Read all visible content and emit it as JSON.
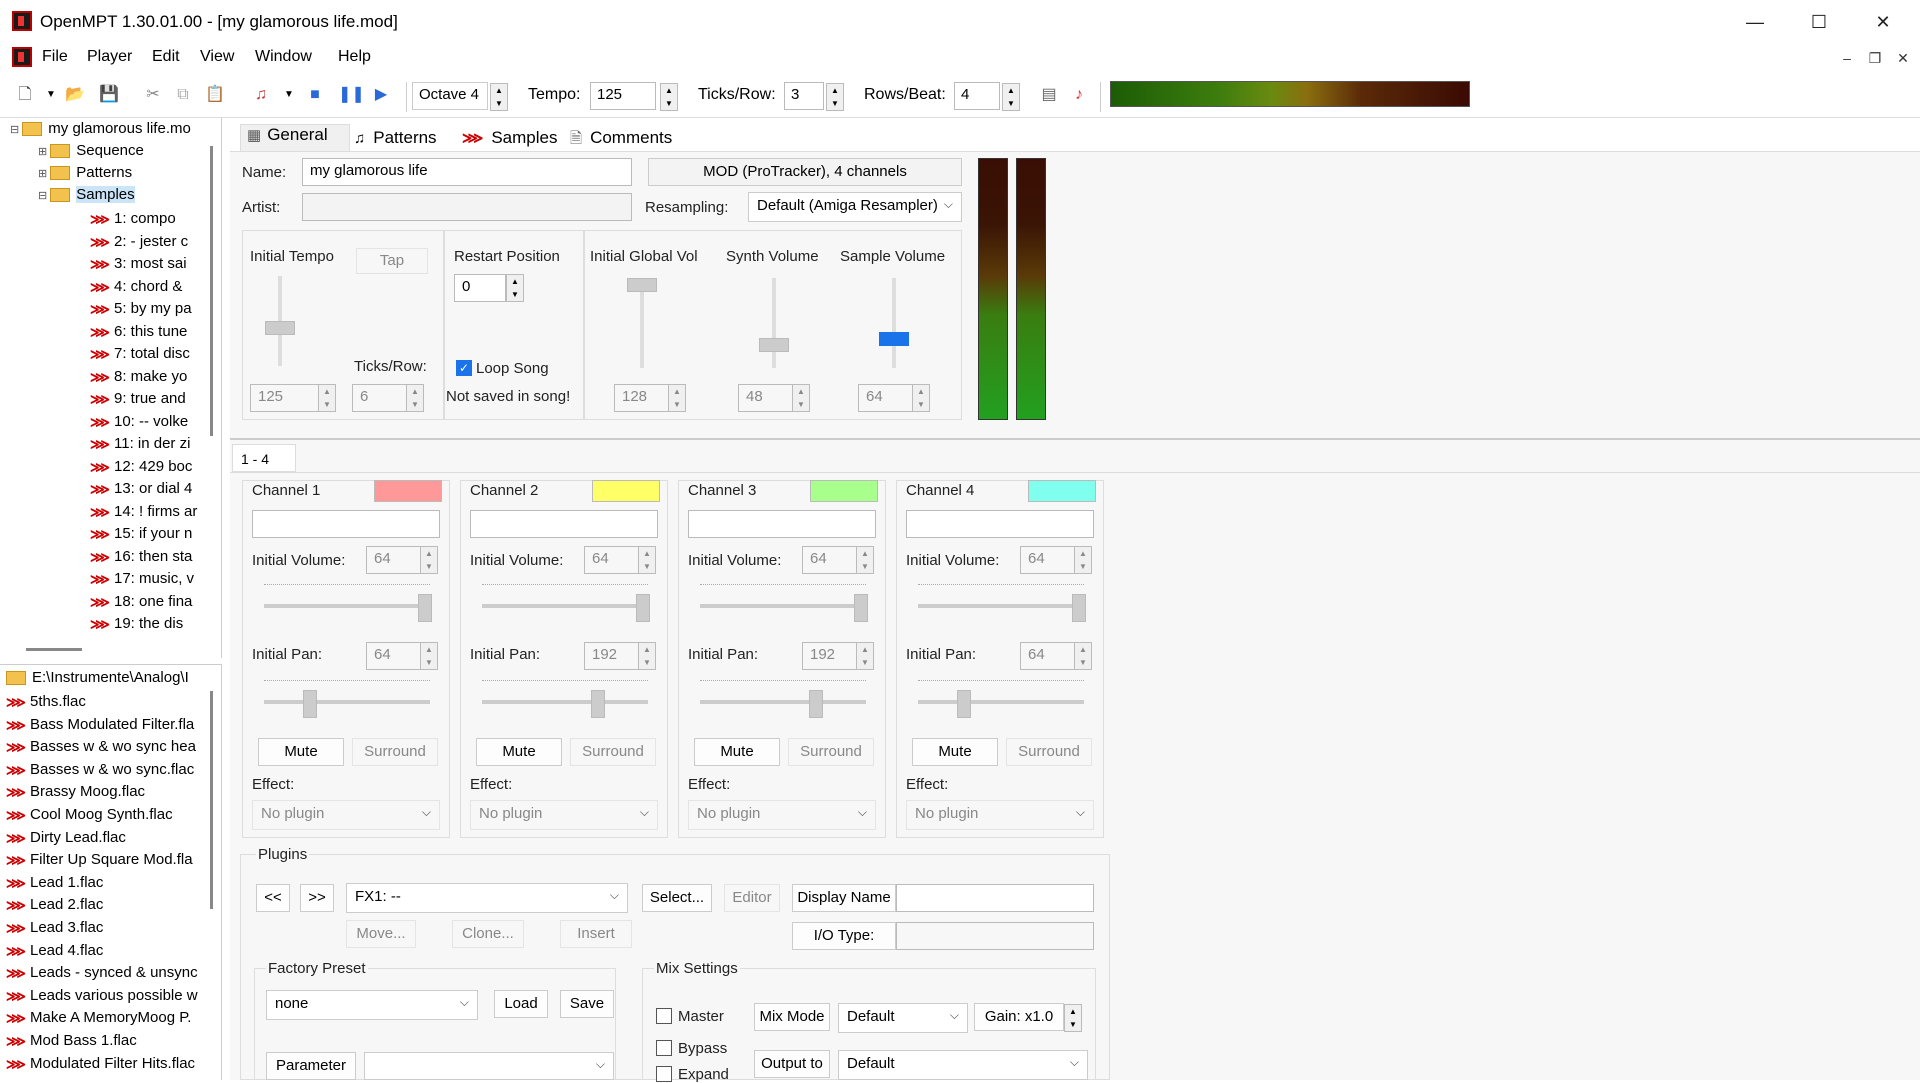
{
  "window": {
    "title": "OpenMPT 1.30.01.00 - [my glamorous life.mod]",
    "minimize": "—",
    "maximize": "☐",
    "close": "✕"
  },
  "menu": {
    "items": [
      "File",
      "Player",
      "Edit",
      "View",
      "Window",
      "Help"
    ]
  },
  "toolbar": {
    "octave": "Octave 4",
    "tempo_label": "Tempo:",
    "tempo": "125",
    "ticks_label": "Ticks/Row:",
    "ticks": "3",
    "rows_label": "Rows/Beat:",
    "rows": "4"
  },
  "tree": {
    "root": "my glamorous life.mo",
    "sequence": "Sequence",
    "patterns": "Patterns",
    "samples": "Samples",
    "items": [
      "1:    compo",
      "2:  - jester c",
      "3:  most sai",
      "4:  chord &",
      "5:  by my pa",
      "6: this tune",
      "7: total disc",
      "8: make yo",
      "9:  true and",
      "10:   -- volke",
      "11: in der zi",
      "12: 429 boc",
      "13: or dial 4",
      "14: ! firms ar",
      "15: if your n",
      "16:  then sta",
      "17:  music, v",
      "18: one fina",
      "19:  the dis"
    ]
  },
  "files": {
    "path": "E:\\Instrumente\\Analog\\I",
    "items": [
      "5ths.flac",
      "Bass Modulated Filter.fla",
      "Basses w & wo sync hea",
      "Basses w & wo sync.flac",
      "Brassy Moog.flac",
      "Cool Moog Synth.flac",
      "Dirty Lead.flac",
      "Filter Up Square Mod.fla",
      "Lead 1.flac",
      "Lead 2.flac",
      "Lead 3.flac",
      "Lead 4.flac",
      "Leads - synced & unsync",
      "Leads various possible w",
      "Make A MemoryMoog P.",
      "Mod Bass 1.flac",
      "Modulated Filter Hits.flac"
    ]
  },
  "tabs": [
    "General",
    "Patterns",
    "Samples",
    "Comments"
  ],
  "general": {
    "name_label": "Name:",
    "name": "my glamorous life",
    "format": "MOD (ProTracker), 4 channels",
    "artist_label": "Artist:",
    "artist": "",
    "resampling_label": "Resampling:",
    "resampling": "Default (Amiga Resampler)",
    "initial_tempo": "Initial Tempo",
    "tap": "Tap",
    "tempo_val": "125",
    "ticks_label": "Ticks/Row:",
    "ticks_val": "6",
    "restart_label": "Restart Position",
    "restart_val": "0",
    "loop_song": "Loop Song",
    "not_saved": "Not saved in song!",
    "global_vol": "Initial Global Vol",
    "global_val": "128",
    "synth_vol": "Synth Volume",
    "synth_val": "48",
    "sample_vol": "Sample Volume",
    "sample_val": "64"
  },
  "channels_tab": "1 - 4",
  "channels": [
    {
      "label": "Channel 1",
      "color": "#ff9999",
      "vol_label": "Initial Volume:",
      "vol": "64",
      "pan_label": "Initial Pan:",
      "pan": "64",
      "pan_level": 0.25,
      "mute": "Mute",
      "surround": "Surround",
      "effect_label": "Effect:",
      "effect": "No plugin"
    },
    {
      "label": "Channel 2",
      "color": "#ffff66",
      "vol_label": "Initial Volume:",
      "vol": "64",
      "pan_label": "Initial Pan:",
      "pan": "192",
      "pan_level": 0.75,
      "mute": "Mute",
      "surround": "Surround",
      "effect_label": "Effect:",
      "effect": "No plugin"
    },
    {
      "label": "Channel 3",
      "color": "#a8ff8c",
      "vol_label": "Initial Volume:",
      "vol": "64",
      "pan_label": "Initial Pan:",
      "pan": "192",
      "pan_level": 0.75,
      "mute": "Mute",
      "surround": "Surround",
      "effect_label": "Effect:",
      "effect": "No plugin"
    },
    {
      "label": "Channel 4",
      "color": "#80ffee",
      "vol_label": "Initial Volume:",
      "vol": "64",
      "pan_label": "Initial Pan:",
      "pan": "64",
      "pan_level": 0.25,
      "mute": "Mute",
      "surround": "Surround",
      "effect_label": "Effect:",
      "effect": "No plugin"
    }
  ],
  "plugins": {
    "title": "Plugins",
    "prev": "<<",
    "next": ">>",
    "fx": "FX1: --",
    "select": "Select...",
    "editor": "Editor",
    "display_name": "Display Name",
    "move": "Move...",
    "clone": "Clone...",
    "insert": "Insert",
    "io_type": "I/O Type:",
    "factory_preset": "Factory Preset",
    "preset": "none",
    "load": "Load",
    "save": "Save",
    "parameter": "Parameter",
    "mix_settings": "Mix Settings",
    "master": "Master",
    "bypass": "Bypass",
    "expand": "Expand",
    "mix_mode": "Mix Mode",
    "mix_mode_val": "Default",
    "gain": "Gain: x1.0",
    "output_to": "Output to",
    "output_val": "Default"
  }
}
